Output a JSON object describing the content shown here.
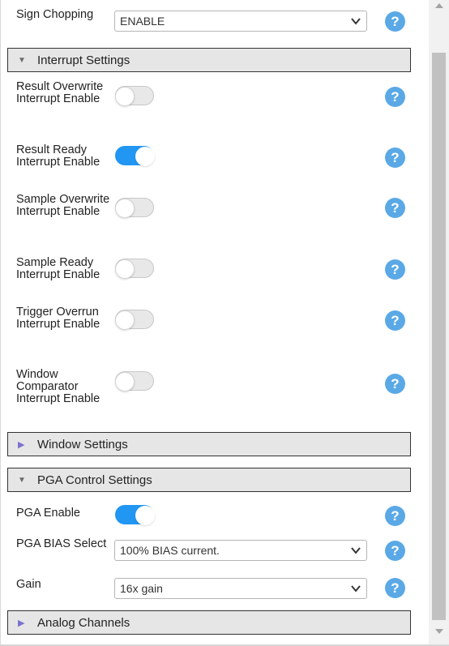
{
  "rows": {
    "sign_chopping": {
      "label": "Sign Chopping",
      "value": "ENABLE"
    },
    "result_overwrite": {
      "label": "Result Overwrite Interrupt Enable",
      "enabled": false
    },
    "result_ready": {
      "label": "Result Ready Interrupt Enable",
      "enabled": true
    },
    "sample_overwrite": {
      "label": "Sample Overwrite Interrupt Enable",
      "enabled": false
    },
    "sample_ready": {
      "label": "Sample Ready Interrupt Enable",
      "enabled": false
    },
    "trigger_overrun": {
      "label": "Trigger Overrun Interrupt Enable",
      "enabled": false
    },
    "window_comparator": {
      "label": "Window Comparator Interrupt Enable",
      "enabled": false
    },
    "pga_enable": {
      "label": "PGA Enable",
      "enabled": true
    },
    "pga_bias": {
      "label": "PGA BIAS Select",
      "value": "100% BIAS current."
    },
    "gain": {
      "label": "Gain",
      "value": "16x gain"
    }
  },
  "sections": {
    "interrupt": {
      "title": "Interrupt Settings",
      "expanded": true
    },
    "window": {
      "title": "Window Settings",
      "expanded": false
    },
    "pga": {
      "title": "PGA Control Settings",
      "expanded": true
    },
    "analog": {
      "title": "Analog Channels",
      "expanded": false
    }
  },
  "help": {
    "glyph": "?"
  },
  "icons": {
    "help": "help-icon",
    "expanded": "triangle-down-icon",
    "collapsed": "triangle-right-icon",
    "dropdown": "chevron-down-icon"
  },
  "colors": {
    "toggle_on": "#2196f3",
    "help": "#5aa9e6",
    "section_bg": "#e6e6e6"
  }
}
